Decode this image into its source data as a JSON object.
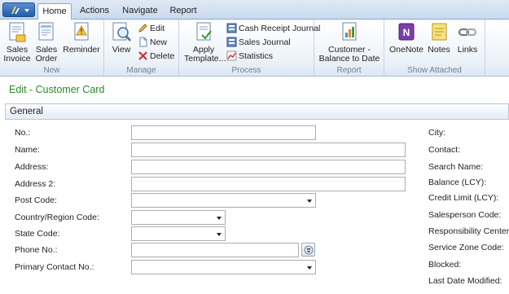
{
  "tabs": [
    {
      "label": "Home",
      "active": true
    },
    {
      "label": "Actions",
      "active": false
    },
    {
      "label": "Navigate",
      "active": false
    },
    {
      "label": "Report",
      "active": false
    }
  ],
  "ribbon": {
    "new_group": {
      "label": "New",
      "buttons": [
        {
          "line1": "Sales",
          "line2": "Invoice",
          "icon": "sales-invoice-icon"
        },
        {
          "line1": "Sales",
          "line2": "Order",
          "icon": "sales-order-icon"
        },
        {
          "line1": "Reminder",
          "line2": "",
          "icon": "reminder-icon"
        }
      ]
    },
    "manage_group": {
      "label": "Manage",
      "view": "View",
      "edit": "Edit",
      "new": "New",
      "delete": "Delete"
    },
    "process_group": {
      "label": "Process",
      "apply_line1": "Apply",
      "apply_line2": "Template...",
      "cash_receipt_journal": "Cash Receipt Journal",
      "sales_journal": "Sales Journal",
      "statistics": "Statistics"
    },
    "report_group": {
      "label": "Report",
      "line1": "Customer -",
      "line2": "Balance to Date"
    },
    "attached_group": {
      "label": "Show Attached",
      "onenote": "OneNote",
      "notes": "Notes",
      "links": "Links"
    }
  },
  "page": {
    "title": "Edit - Customer Card",
    "fasttab": "General"
  },
  "form": {
    "left_labels": {
      "no": "No.:",
      "name": "Name:",
      "address": "Address:",
      "address2": "Address 2:",
      "post_code": "Post Code:",
      "country": "Country/Region Code:",
      "state": "State Code:",
      "phone": "Phone No.:",
      "primary_contact": "Primary Contact No.:"
    },
    "values": {
      "no": "",
      "name": "",
      "address": "",
      "address2": "",
      "phone": ""
    },
    "right_labels": {
      "city": "City:",
      "contact": "Contact:",
      "search_name": "Search Name:",
      "balance": "Balance (LCY):",
      "credit_limit": "Credit Limit (LCY):",
      "salesperson": "Salesperson Code:",
      "responsibility": "Responsibility Center:",
      "service_zone": "Service Zone Code:",
      "blocked": "Blocked:",
      "last_modified": "Last Date Modified:"
    }
  },
  "colors": {
    "title_green": "#2d8a2d",
    "ribbon_label": "#6d7f99",
    "tab_border": "#8ba7cb"
  }
}
